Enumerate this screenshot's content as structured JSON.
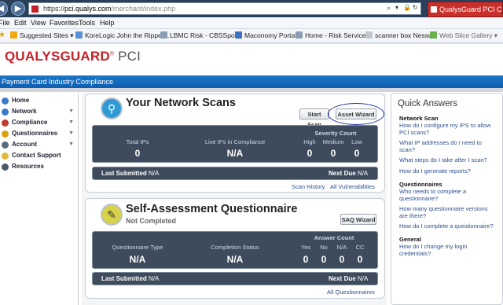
{
  "browser": {
    "url_prefix": "https://",
    "url_domain": "pci.qualys.com",
    "url_path": "/merchant/index.php",
    "tab_title": "QualysGuard PCI Compl",
    "menu": [
      "File",
      "Edit",
      "View",
      "Favorites",
      "Tools",
      "Help"
    ],
    "favorites": [
      {
        "label": "Suggested Sites ▾",
        "color": "#f2a90f"
      },
      {
        "label": "KoreLogic John the Ripper...",
        "color": "#5b8fd6"
      },
      {
        "label": "LBMC Risk - CBSSports",
        "color": "#8a9fb3"
      },
      {
        "label": "Maconomy Portal",
        "color": "#3c6fc4"
      },
      {
        "label": "Home - Risk Services",
        "color": "#8a9fb3"
      },
      {
        "label": "scanner box Nessus",
        "color": "#c0c7cf"
      },
      {
        "label": "Web Slice Gallery ▾",
        "color": "#6ab04c"
      }
    ]
  },
  "app": {
    "logo_main": "QUALYSGUARD",
    "logo_reg": "®",
    "logo_pci": " PCI",
    "banner": "Payment Card Industry Compliance"
  },
  "sidebar": {
    "items": [
      {
        "label": "Home",
        "icon": "home-icon",
        "color": "#3a7bc8",
        "arrow": ""
      },
      {
        "label": "Network",
        "icon": "network-icon",
        "color": "#3a7bc8",
        "arrow": "▼"
      },
      {
        "label": "Compliance",
        "icon": "compliance-icon",
        "color": "#c23b2d",
        "arrow": "▼"
      },
      {
        "label": "Questionnaires",
        "icon": "questionnaires-icon",
        "color": "#d9a20f",
        "arrow": "▼"
      },
      {
        "label": "Account",
        "icon": "account-icon",
        "color": "#5a6b7c",
        "arrow": "▼"
      },
      {
        "label": "Contact Support",
        "icon": "support-icon",
        "color": "#e3b93a",
        "arrow": ""
      },
      {
        "label": "Resources",
        "icon": "resources-icon",
        "color": "#4a5866",
        "arrow": ""
      }
    ]
  },
  "scans": {
    "title": "Your Network Scans",
    "start_scan": "Start Scan",
    "asset_wizard": "Asset Wizard",
    "total_ips_label": "Total IPs",
    "total_ips": "0",
    "live_ips_label": "Live IPs in Compliance",
    "live_ips": "N/A",
    "severity_label": "Severity Count",
    "sev_cols": [
      "High",
      "Medium",
      "Low"
    ],
    "sev_vals": [
      "0",
      "0",
      "0"
    ],
    "last_submitted": "Last Submitted",
    "last_submitted_val": "N/A",
    "next_due": "Next Due",
    "next_due_val": "N/A",
    "scan_history": "Scan History",
    "all_vulns": "All Vulnerabilities"
  },
  "saq": {
    "title": "Self-Assessment Questionnaire",
    "status": "Not Completed",
    "wizard": "SAQ Wizard",
    "qtype_label": "Questionnaire Type",
    "qtype": "N/A",
    "comp_label": "Completion Status",
    "comp": "N/A",
    "answer_label": "Answer Count",
    "ans_cols": [
      "Yes",
      "No",
      "N/A",
      "CC"
    ],
    "ans_vals": [
      "0",
      "0",
      "0",
      "0"
    ],
    "last_submitted": "Last Submitted",
    "last_submitted_val": "N/A",
    "next_due": "Next Due",
    "next_due_val": "N/A",
    "all_q": "All Questionnaires"
  },
  "quick": {
    "title": "Quick Answers",
    "network_heading": "Network Scan",
    "network_links": [
      "How do I configure my IPS to allow PCI scans?",
      "What IP addresses do I need to scan?",
      "What steps do I take after I scan?",
      "How do I generate reports?"
    ],
    "q_heading": "Questionnaires",
    "q_links": [
      "Who needs to complete a questionnaire?",
      "How many questionnaire versions are there?",
      "How do I complete a questionnaire?"
    ],
    "general_heading": "General",
    "general_links": [
      "How do I change my login credentials?"
    ]
  }
}
